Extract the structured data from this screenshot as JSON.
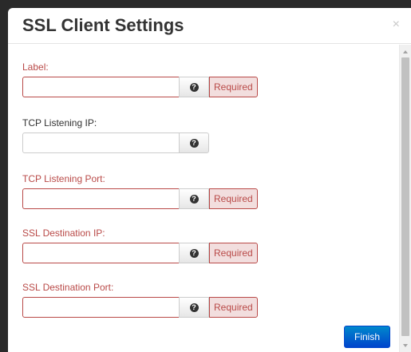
{
  "modal": {
    "title": "SSL Client Settings",
    "close_glyph": "×"
  },
  "fields": [
    {
      "label": "Label:",
      "value": "",
      "placeholder": "",
      "required": true,
      "required_text": "Required",
      "help_icon": "question-circle-icon"
    },
    {
      "label": "TCP Listening IP:",
      "value": "",
      "placeholder": "",
      "required": false,
      "help_icon": "question-circle-icon"
    },
    {
      "label": "TCP Listening Port:",
      "value": "",
      "placeholder": "",
      "required": true,
      "required_text": "Required",
      "help_icon": "question-circle-icon"
    },
    {
      "label": "SSL Destination IP:",
      "value": "",
      "placeholder": "",
      "required": true,
      "required_text": "Required",
      "help_icon": "question-circle-icon"
    },
    {
      "label": "SSL Destination Port:",
      "value": "",
      "placeholder": "",
      "required": true,
      "required_text": "Required",
      "help_icon": "question-circle-icon"
    }
  ],
  "footer": {
    "finish_label": "Finish"
  },
  "colors": {
    "error_text": "#b94a48",
    "error_bg": "#f2dede",
    "primary_button": "#0074cc",
    "title_text": "#333333"
  }
}
